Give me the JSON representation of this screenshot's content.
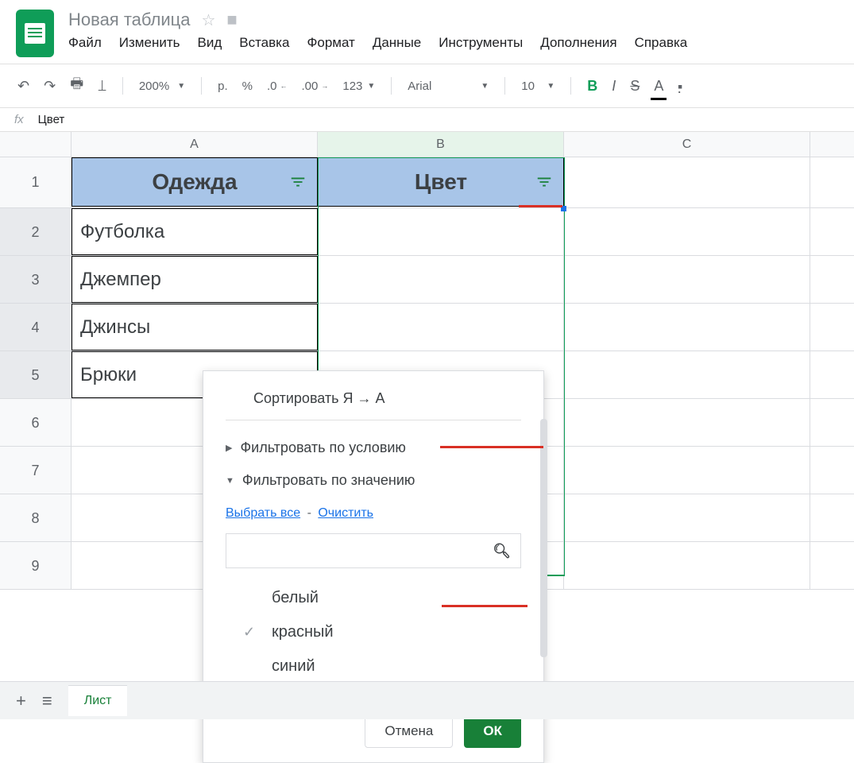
{
  "doc": {
    "title": "Новая таблица"
  },
  "menu": {
    "file": "Файл",
    "edit": "Изменить",
    "view": "Вид",
    "insert": "Вставка",
    "format": "Формат",
    "data": "Данные",
    "tools": "Инструменты",
    "addons": "Дополнения",
    "help": "Справка"
  },
  "toolbar": {
    "zoom": "200%",
    "currency": "р.",
    "percent": "%",
    "dec_dec": ".0",
    "dec_inc": ".00",
    "numformat": "123",
    "font": "Arial",
    "font_size": "10"
  },
  "formula": {
    "label": "fx",
    "value": "Цвет"
  },
  "columns": {
    "a": "A",
    "b": "B",
    "c": "C"
  },
  "rows": [
    "1",
    "2",
    "3",
    "4",
    "5",
    "6",
    "7",
    "8",
    "9"
  ],
  "headers": {
    "a": "Одежда",
    "b": "Цвет"
  },
  "data_rows": [
    {
      "a": "Футболка"
    },
    {
      "a": "Джемпер"
    },
    {
      "a": "Джинсы"
    },
    {
      "a": "Брюки"
    }
  ],
  "filter": {
    "sort_za": "Сортировать Я → А",
    "by_condition": "Фильтровать по условию",
    "by_value": "Фильтровать по значению",
    "select_all": "Выбрать все",
    "clear": "Очистить",
    "search_placeholder": "",
    "values": [
      {
        "label": "белый",
        "checked": false
      },
      {
        "label": "красный",
        "checked": true
      },
      {
        "label": "синий",
        "checked": false
      }
    ],
    "cancel": "Отмена",
    "ok": "ОК"
  },
  "sheet": {
    "name": "Лист"
  }
}
